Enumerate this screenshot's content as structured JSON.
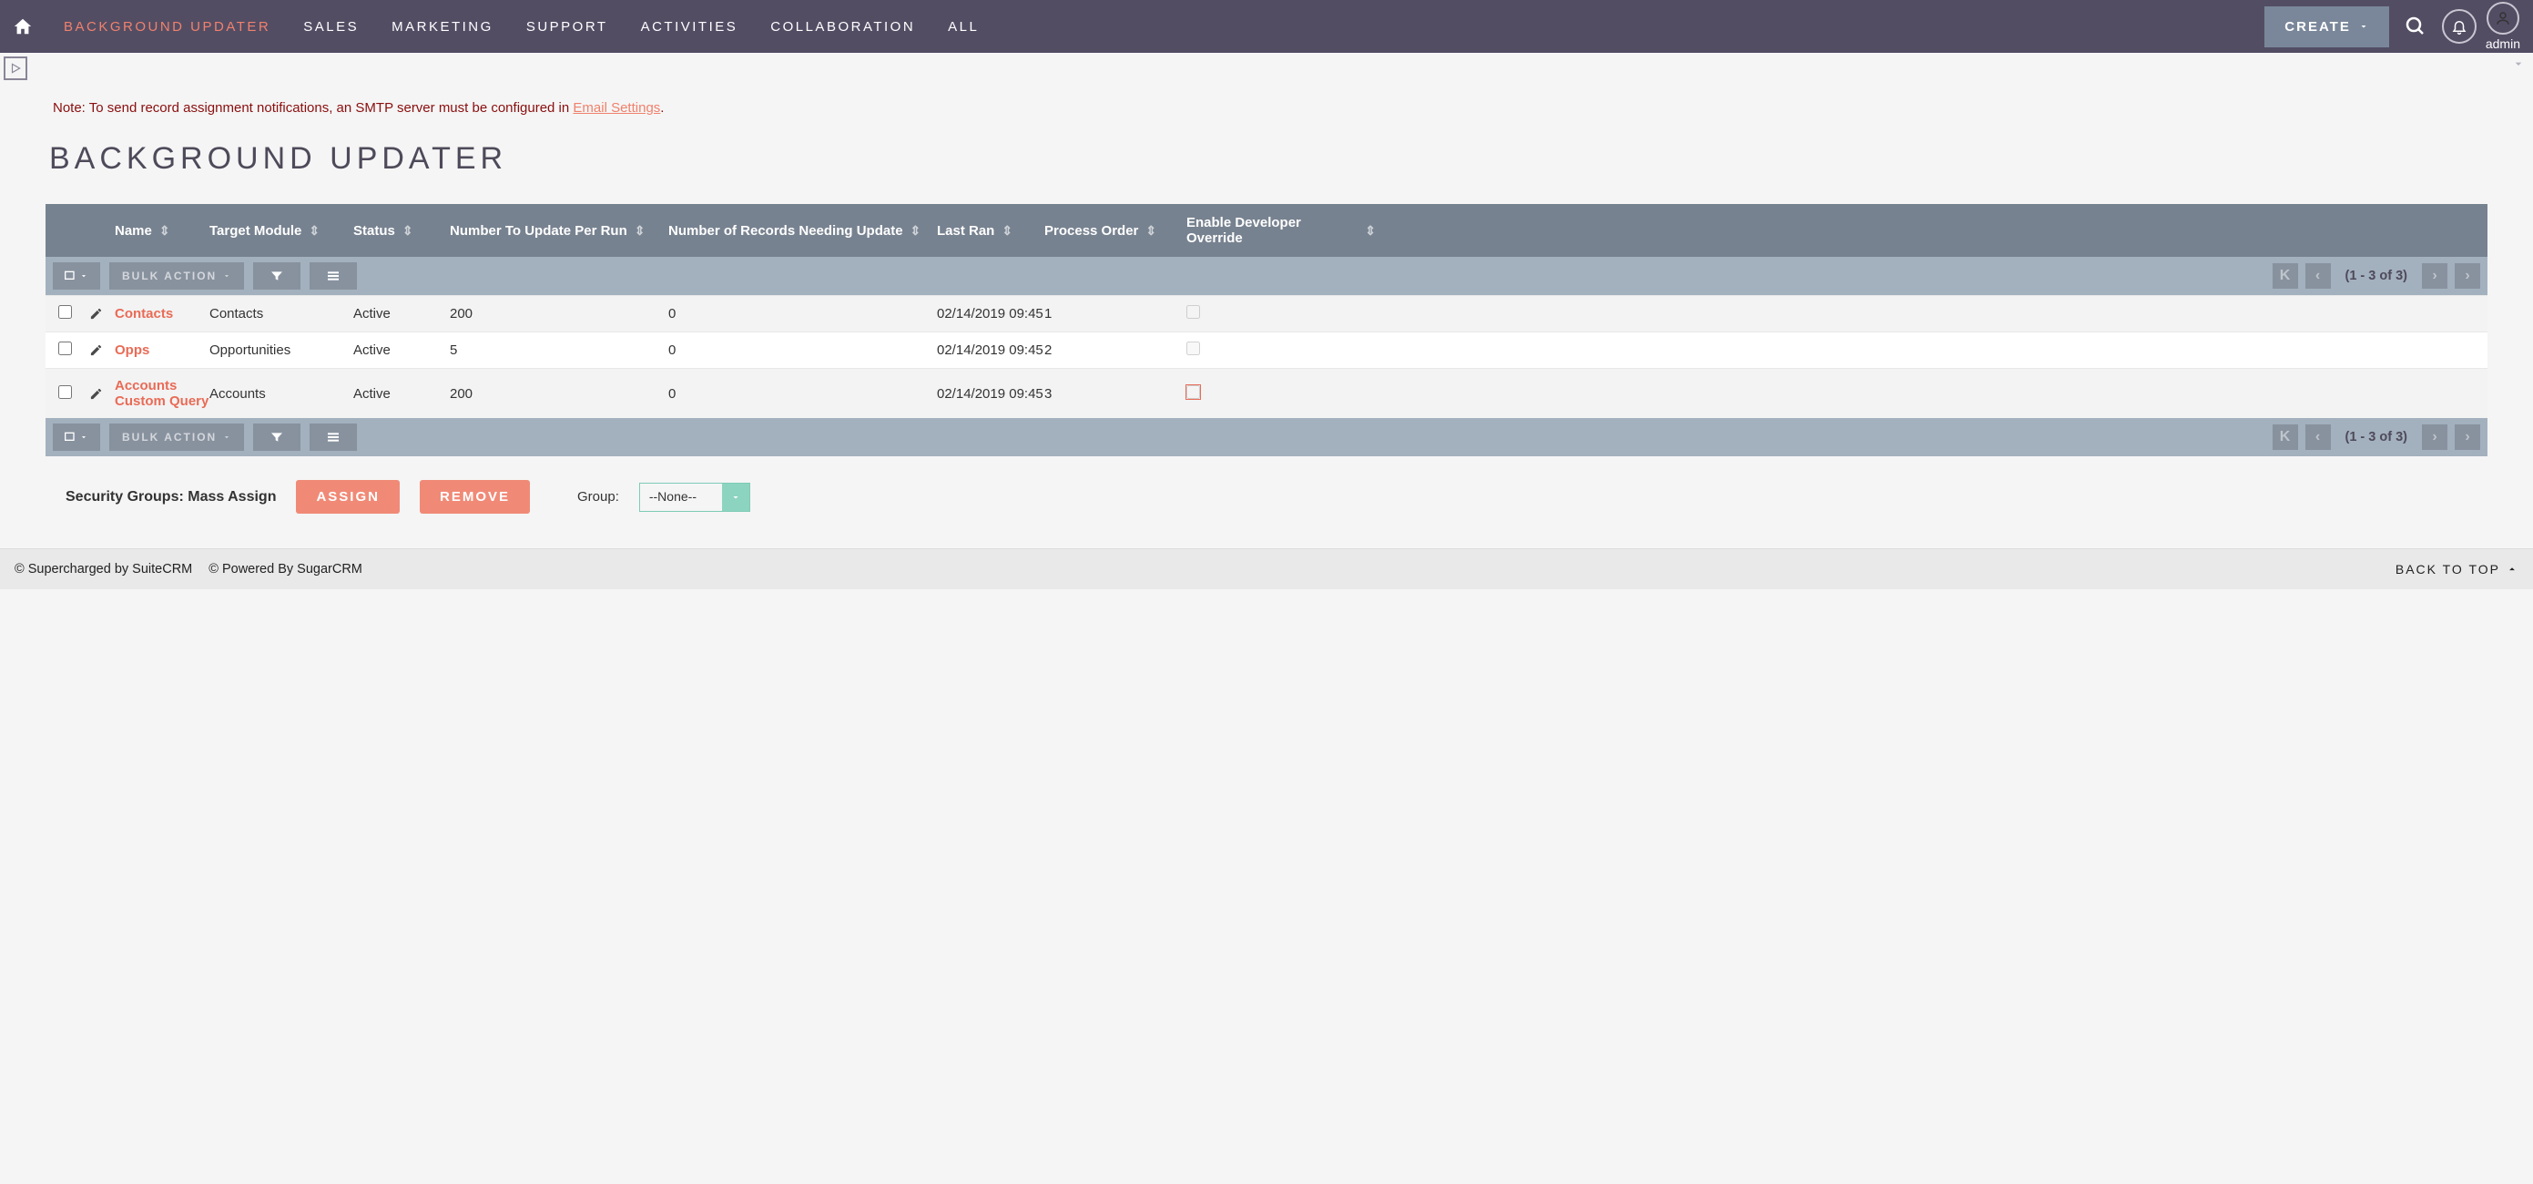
{
  "topnav": {
    "items": [
      {
        "label": "BACKGROUND UPDATER",
        "active": true
      },
      {
        "label": "SALES"
      },
      {
        "label": "MARKETING"
      },
      {
        "label": "SUPPORT"
      },
      {
        "label": "ACTIVITIES"
      },
      {
        "label": "COLLABORATION"
      },
      {
        "label": "ALL"
      }
    ],
    "create_label": "CREATE",
    "user_label": "admin"
  },
  "note": {
    "text": "Note: To send record assignment notifications, an SMTP server must be configured in ",
    "link_label": "Email Settings",
    "suffix": "."
  },
  "page_title": "BACKGROUND UPDATER",
  "table": {
    "columns": [
      "Name",
      "Target Module",
      "Status",
      "Number To Update Per Run",
      "Number of Records Needing Update",
      "Last Ran",
      "Process Order",
      "Enable Developer Override"
    ],
    "bulk_label": "BULK ACTION",
    "page_range": "(1 - 3 of 3)",
    "rows": [
      {
        "name": "Contacts",
        "target": "Contacts",
        "status": "Active",
        "num_update": "200",
        "need": "0",
        "last_ran": "02/14/2019 09:45",
        "order": "1",
        "dev_override": false
      },
      {
        "name": "Opps",
        "target": "Opportunities",
        "status": "Active",
        "num_update": "5",
        "need": "0",
        "last_ran": "02/14/2019 09:45",
        "order": "2",
        "dev_override": false
      },
      {
        "name": "Accounts Custom Query",
        "target": "Accounts",
        "status": "Active",
        "num_update": "200",
        "need": "0",
        "last_ran": "02/14/2019 09:45",
        "order": "3",
        "dev_override": true
      }
    ]
  },
  "mass_assign": {
    "label": "Security Groups: Mass Assign",
    "assign_label": "ASSIGN",
    "remove_label": "REMOVE",
    "group_label": "Group:",
    "group_value": "--None--"
  },
  "footer": {
    "left1": "© Supercharged by SuiteCRM",
    "left2": "© Powered By SugarCRM",
    "backtop": "BACK TO TOP"
  }
}
